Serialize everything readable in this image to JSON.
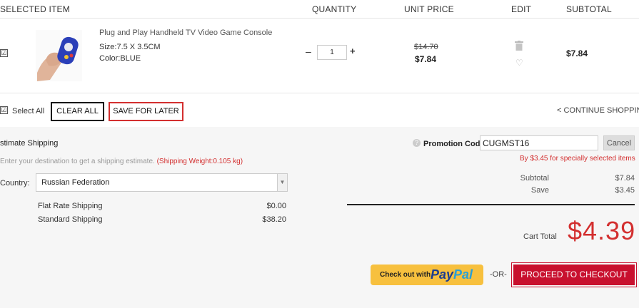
{
  "header": {
    "selected_item": "SELECTED ITEM",
    "quantity": "QUANTITY",
    "unit_price": "UNIT PRICE",
    "edit": "EDIT",
    "subtotal": "SUBTOTAL"
  },
  "item": {
    "checked": "☑",
    "name": "Plug and Play Handheld TV Video Game Console",
    "size": "Size:7.5 X 3.5CM",
    "color": "Color:BLUE",
    "qty_minus": "–",
    "quantity": "1",
    "qty_plus": "+",
    "old_price": "$14.70",
    "unit_price": "$7.84",
    "subtotal": "$7.84",
    "trash_icon": "🗑",
    "heart_icon": "♡"
  },
  "actions": {
    "select_all_check": "☑",
    "select_all": "Select All",
    "clear_all": "CLEAR ALL",
    "save_for_later": "SAVE FOR LATER",
    "continue_shopping": "< CONTINUE SHOPPIN"
  },
  "shipping": {
    "title": "stimate Shipping",
    "hint": "Enter your destination to get a shipping estimate.",
    "weight": "(Shipping Weight:0.105 kg)",
    "country_label": "Country:",
    "country": "Russian Federation",
    "options": [
      {
        "name": "Flat Rate Shipping",
        "price": "$0.00"
      },
      {
        "name": "Standard Shipping",
        "price": "$38.20"
      }
    ]
  },
  "promo": {
    "icon": "?",
    "label": "Promotion Code:",
    "code": "CUGMST16",
    "cancel": "Cancel",
    "message": "By $3.45 for specially selected items"
  },
  "summary": {
    "subtotal_label": "Subtotal",
    "subtotal": "$7.84",
    "save_label": "Save",
    "save": "$3.45",
    "cart_total_label": "Cart Total",
    "cart_total": "$4.39"
  },
  "checkout": {
    "paypal_prefix": "Check out with",
    "paypal_brand_1": "Pay",
    "paypal_brand_2": "Pal",
    "or": "-OR-",
    "proceed": "PROCEED TO CHECKOUT"
  },
  "colors": {
    "accent_red": "#d32f2f",
    "checkout_red": "#c8102e",
    "paypal_yellow": "#f7c03e"
  }
}
